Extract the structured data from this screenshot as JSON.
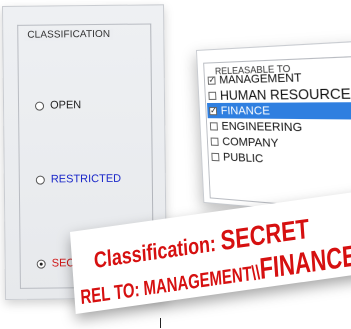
{
  "classification": {
    "legend": "CLASSIFICATION",
    "options": [
      {
        "label": "OPEN",
        "checked": false
      },
      {
        "label": "RESTRICTED",
        "checked": false
      },
      {
        "label": "SECRET",
        "checked": true
      }
    ]
  },
  "releasable_to": {
    "legend": "RELEASABLE TO",
    "items": [
      {
        "label": "MANAGEMENT",
        "checked": true,
        "selected": false
      },
      {
        "label": "HUMAN RESOURCES",
        "checked": false,
        "selected": false
      },
      {
        "label": "FINANCE",
        "checked": true,
        "selected": true
      },
      {
        "label": "ENGINEERING",
        "checked": false,
        "selected": false
      },
      {
        "label": "COMPANY",
        "checked": false,
        "selected": false
      },
      {
        "label": "PUBLIC",
        "checked": false,
        "selected": false
      }
    ]
  },
  "banner": {
    "line1_prefix": "Classification: ",
    "line1_value": "SECRET",
    "line2_prefix": "REL TO: MANAGEMENT\\\\",
    "line2_value": "FINANCE"
  },
  "colors": {
    "restricted": "#1a27c9",
    "secret": "#d01818",
    "selection": "#2f7fe0"
  }
}
